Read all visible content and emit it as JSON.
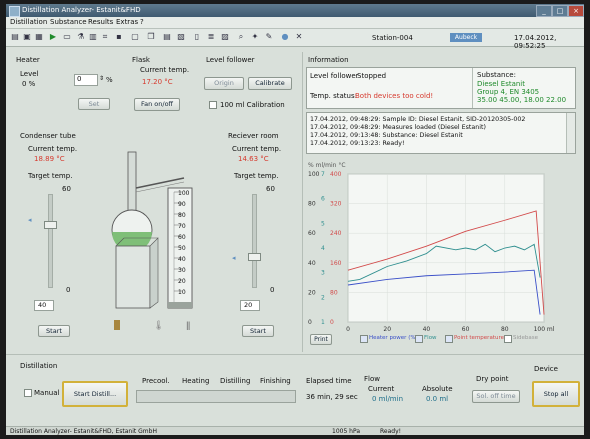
{
  "window": {
    "title": "Distillation Analyzer- Estanit&FHD"
  },
  "menu": [
    "Distillation",
    "Substance",
    "Results",
    "Extras",
    "?"
  ],
  "toolbar": {
    "station": "Station-004",
    "user": "Aubeck",
    "datetime": "17.04.2012, 09:52:25"
  },
  "heater": {
    "title": "Heater",
    "level_label": "Level",
    "level_value": "0 %",
    "spin_value": "0",
    "spin_unit": "%",
    "set_label": "Set"
  },
  "flask": {
    "title": "Flask",
    "current_label": "Current temp.",
    "current_value": "17.20 °C",
    "fan_label": "Fan on/off"
  },
  "level_follower": {
    "title": "Level follower",
    "origin_label": "Origin",
    "calibrate_label": "Calibrate",
    "calib100_label": "100 ml Calibration"
  },
  "information": {
    "title": "Information",
    "follower_label": "Level follower",
    "follower_value": "Stopped",
    "temp_label": "Temp. status:",
    "temp_value": "Both devices too cold!",
    "substance_label": "Substance:",
    "substance_lines": [
      "Diesel Estanit",
      "Group 4, EN 3405",
      "35.00 45.00, 18.00 22.00"
    ],
    "log": [
      "17.04.2012, 09:48:29:  Sample ID: Diesel Estanit, SID-20120305-002",
      "17.04.2012, 09:48:29:  Measures loaded (Diesel Estanit)",
      "17.04.2012, 09:13:48:  Substance: Diesel Estanit",
      "17.04.2012, 09:13:23:  Ready!"
    ]
  },
  "condenser": {
    "title": "Condenser tube",
    "current_label": "Current temp.",
    "current_value": "18.89 °C",
    "target_label": "Target temp.",
    "target_max": "60",
    "target_min": "0",
    "target_value": "40",
    "target_fraction": 0.67,
    "start_label": "Start"
  },
  "receiver": {
    "title": "Reciever room",
    "current_label": "Current temp.",
    "current_value": "14.63 °C",
    "target_label": "Target temp.",
    "target_max": "60",
    "target_min": "0",
    "target_value": "20",
    "target_fraction": 0.33,
    "start_label": "Start"
  },
  "cylinder_scale": [
    "100",
    "90",
    "80",
    "70",
    "60",
    "50",
    "40",
    "30",
    "20",
    "10"
  ],
  "chart_data": {
    "type": "line",
    "y_units": "% ml/min °C",
    "y_ticks_percent": [
      "100",
      "80",
      "60",
      "40",
      "20",
      "0"
    ],
    "y_ticks_flow": [
      "7",
      "6",
      "5",
      "4",
      "3",
      "2",
      "1"
    ],
    "y_ticks_temp": [
      "400",
      "320",
      "240",
      "160",
      "80",
      "0"
    ],
    "x_ticks": [
      "0",
      "20",
      "40",
      "60",
      "80",
      "100 ml"
    ],
    "xlim": [
      0,
      100
    ],
    "ylim": [
      0,
      400
    ],
    "series": [
      {
        "name": "Heater power (%)",
        "color": "#3b50c8",
        "x": [
          0,
          20,
          40,
          60,
          80,
          95,
          98
        ],
        "y": [
          100,
          115,
          125,
          130,
          135,
          140,
          20
        ]
      },
      {
        "name": "Flow",
        "color": "#2f8f8f",
        "x": [
          0,
          6,
          20,
          30,
          40,
          45,
          55,
          60,
          65,
          70,
          75,
          80,
          85,
          90,
          95,
          98
        ],
        "y": [
          110,
          115,
          150,
          165,
          185,
          205,
          195,
          200,
          195,
          210,
          190,
          200,
          205,
          195,
          210,
          120
        ]
      },
      {
        "name": "Point temperature",
        "color": "#d24a4a",
        "x": [
          0,
          20,
          40,
          60,
          80,
          96,
          100
        ],
        "y": [
          140,
          170,
          205,
          245,
          275,
          300,
          20
        ]
      }
    ],
    "legend": [
      "Heater power (%)",
      "Flow",
      "Point temperature",
      "Sidebase"
    ],
    "print_label": "Print"
  },
  "distillation": {
    "title": "Distillation",
    "manual_label": "Manual",
    "start_label": "Start Distill...",
    "phases": [
      "Precool.",
      "Heating",
      "Distilling",
      "Finishing"
    ],
    "elapsed_label": "Elapsed time",
    "elapsed_value": "36 min, 29 sec",
    "flow_label": "Flow",
    "current_label": "Current",
    "current_value": "0   ml/min",
    "absolute_label": "Absolute",
    "absolute_value": "0.0 ml",
    "drypoint_label": "Dry point",
    "drypoint_btn": "Sol. off time",
    "device_label": "Device",
    "stop_label": "Stop all"
  },
  "status": {
    "left": "Distillation Analyzer- Estanit&FHD, Estanit GmbH",
    "pressure": "1005 hPa",
    "state": "Ready!"
  },
  "colors": {
    "accent": "#5f8fc0",
    "red": "#d63a2e",
    "green": "#1f8a2b"
  }
}
